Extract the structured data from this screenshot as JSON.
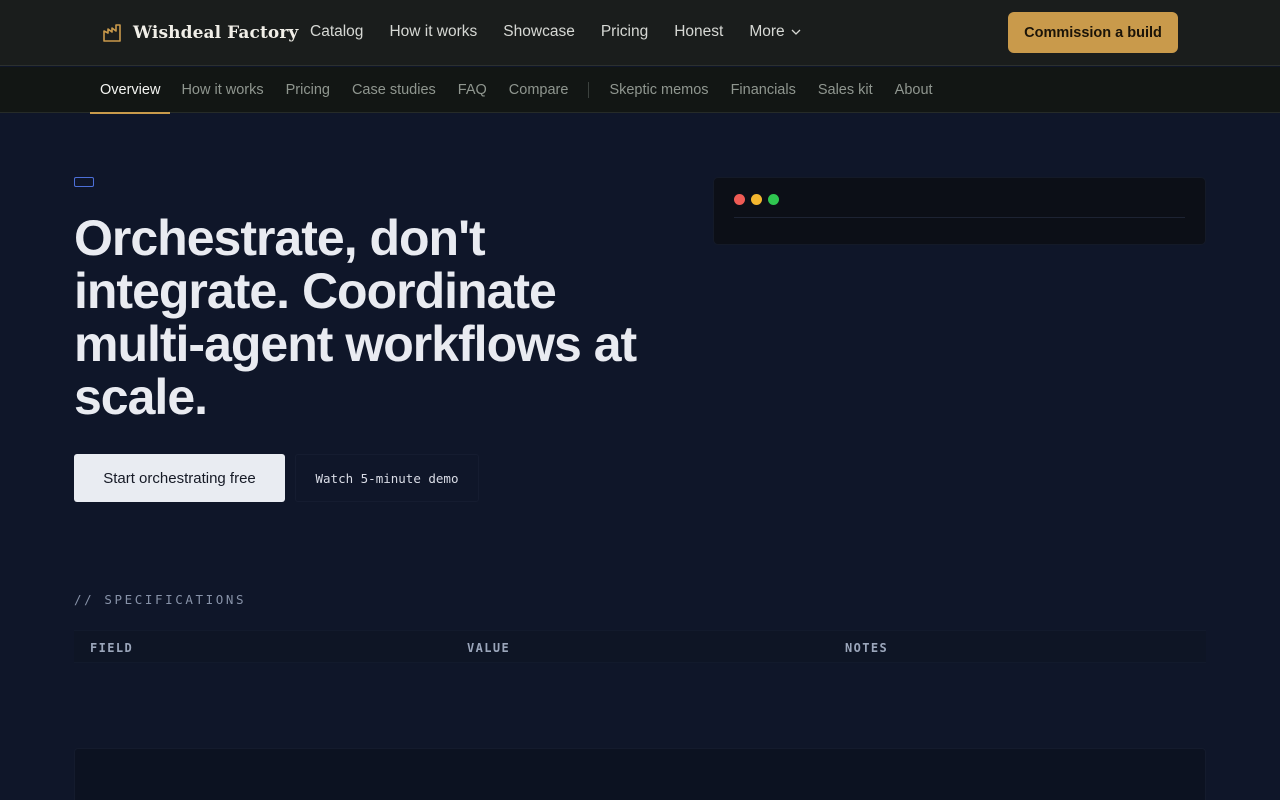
{
  "brand": {
    "name": "Wishdeal Factory",
    "icon": "factory-icon",
    "accent": "#c99a4b"
  },
  "primary_nav": {
    "items": [
      {
        "label": "Catalog"
      },
      {
        "label": "How it works"
      },
      {
        "label": "Showcase"
      },
      {
        "label": "Pricing"
      },
      {
        "label": "Honest"
      },
      {
        "label": "More",
        "icon": "chevron-down-icon"
      }
    ],
    "cta": "Commission a build"
  },
  "sub_nav": {
    "active": "Overview",
    "group_one": [
      "Overview",
      "How it works",
      "Pricing",
      "Case studies",
      "FAQ",
      "Compare"
    ],
    "group_two": [
      "Skeptic memos",
      "Financials",
      "Sales kit",
      "About"
    ]
  },
  "hero": {
    "title": "Orchestrate, don't integrate. Coordinate multi-agent workflows at scale.",
    "primary_button": "Start orchestrating free",
    "secondary_button": "Watch 5-minute demo"
  },
  "terminal": {
    "dots": [
      "#ef5b55",
      "#f3b62f",
      "#2fc650"
    ]
  },
  "specifications": {
    "heading": "// SPECIFICATIONS",
    "columns": [
      "FIELD",
      "VALUE",
      "NOTES"
    ]
  }
}
